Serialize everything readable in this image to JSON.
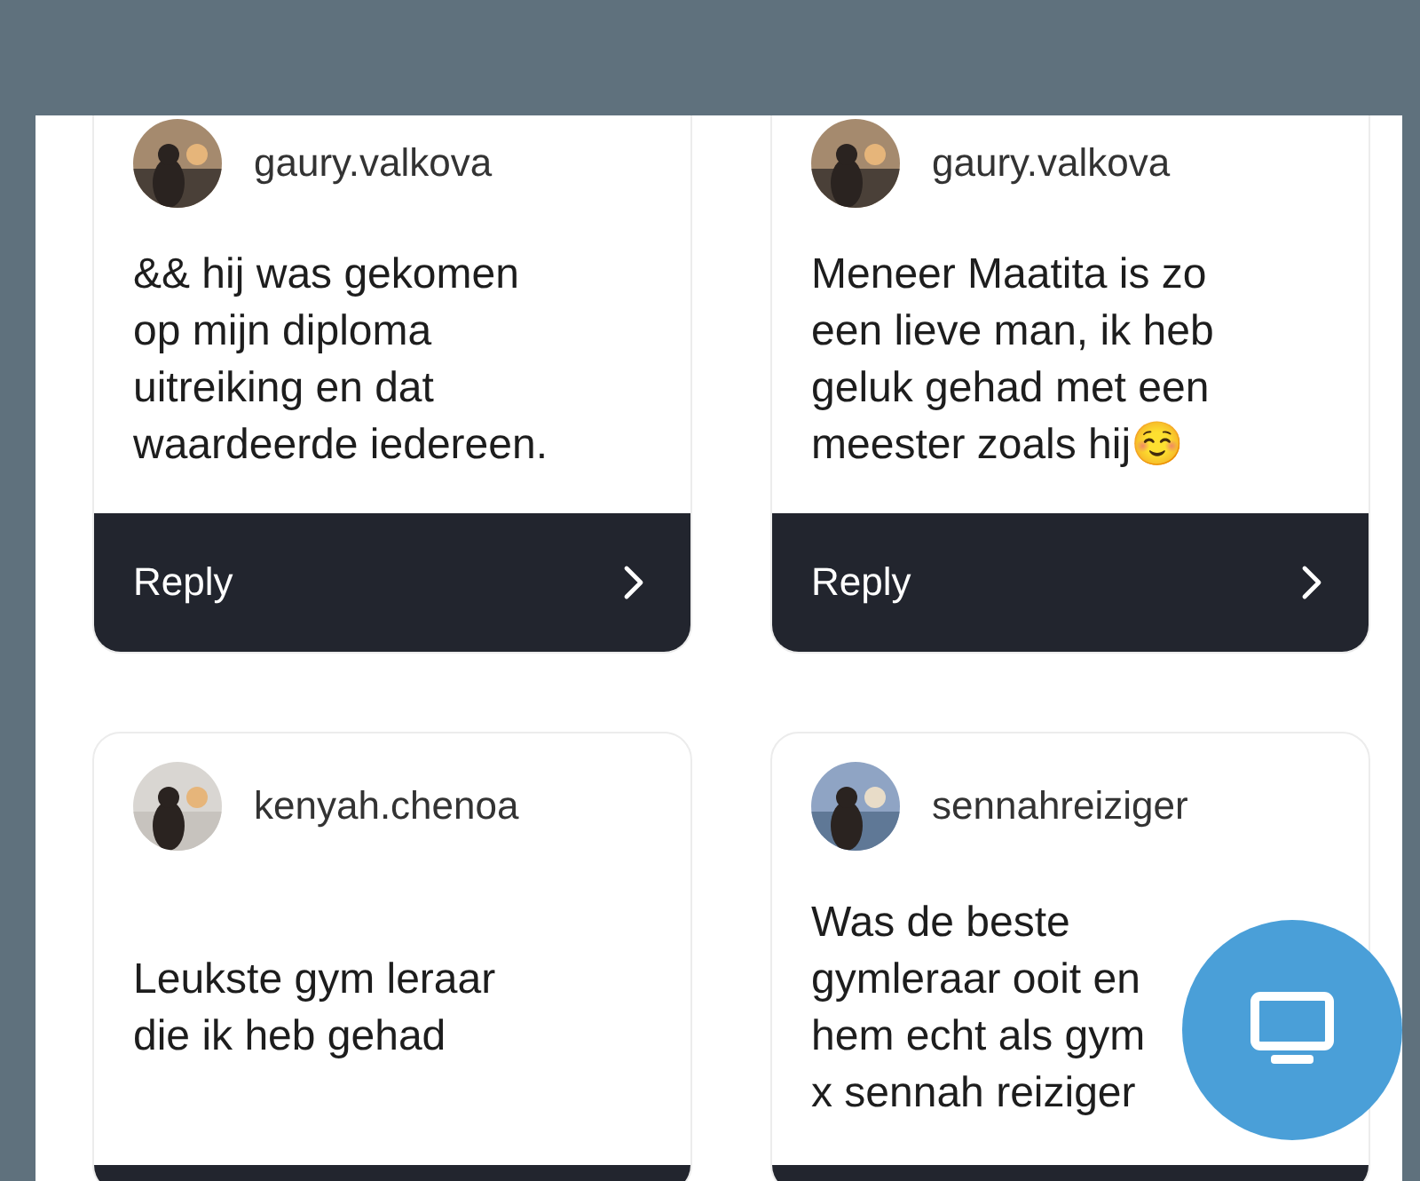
{
  "cards": [
    {
      "username": "gaury.valkova",
      "text": "&& hij was gekomen\nop mijn diploma\nuitreiking en dat\nwaardeerde iedereen.",
      "reply": "Reply"
    },
    {
      "username": "gaury.valkova",
      "text": "Meneer Maatita is zo\neen lieve man, ik heb\ngeluk gehad met een\nmeester zoals hij☺️",
      "reply": "Reply"
    },
    {
      "username": "kenyah.chenoa",
      "text": "Leukste gym leraar\ndie ik heb gehad"
    },
    {
      "username": "sennahreiziger",
      "text": "Was de beste\ngymleraar ooit en\nhem echt als gym\nx sennah reiziger"
    }
  ]
}
